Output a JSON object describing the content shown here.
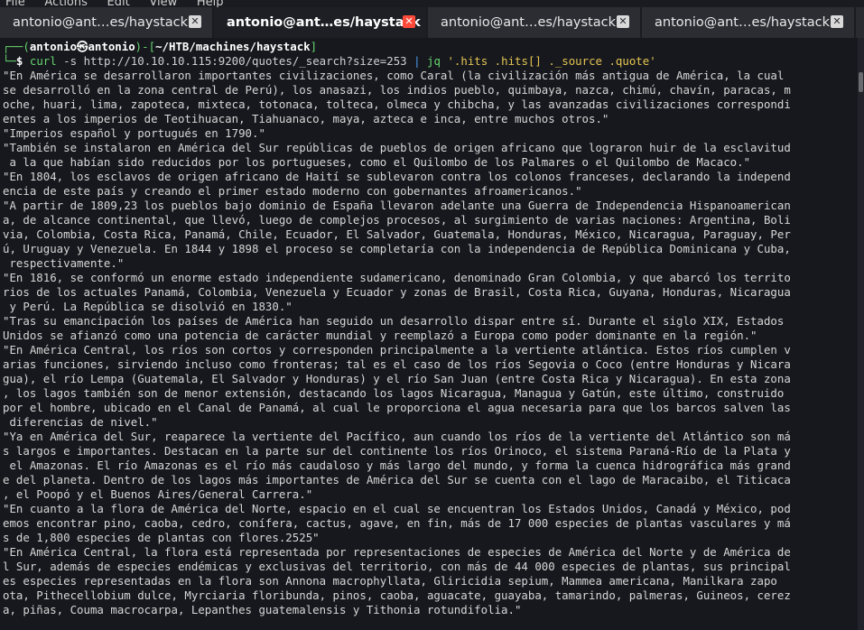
{
  "menubar": {
    "items": [
      "File",
      "Actions",
      "Edit",
      "View",
      "Help"
    ]
  },
  "tabs": [
    {
      "label": "antonio@ant…es/haystack",
      "active": false
    },
    {
      "label": "antonio@ant…es/haystack",
      "active": true
    },
    {
      "label": "antonio@ant…es/haystack",
      "active": false
    },
    {
      "label": "antonio@ant…es/haystack",
      "active": false
    }
  ],
  "colors": {
    "tab_close_active": "#ff4a3a",
    "prompt_blue": "#4c9be8",
    "prompt_green": "#66d36e"
  },
  "prompt": {
    "open": "┌──(",
    "user": "antonio㉿antonio",
    "mid": ")-[",
    "path": "~/HTB/machines/haystack",
    "close": "]",
    "second": "└─",
    "symbol": "$",
    "cmd_name": "curl",
    "cmd_flag": "-s",
    "cmd_url": "http://10.10.10.115:9200/quotes/_search?size=253",
    "pipe": "|",
    "cmd_jq": "jq",
    "cmd_filter": "'.hits .hits[] ._source .quote'"
  },
  "output_lines": [
    "\"En América se desarrollaron importantes civilizaciones, como Caral (la civilización más antigua de América, la cual",
    "se desarrolló en la zona central de Perú), los anasazi, los indios pueblo, quimbaya, nazca, chimú, chavín, paracas, m",
    "oche, huari, lima, zapoteca, mixteca, totonaca, tolteca, olmeca y chibcha, y las avanzadas civilizaciones correspondi",
    "entes a los imperios de Teotihuacan, Tiahuanaco, maya, azteca e inca, entre muchos otros.\"",
    "\"Imperios español y portugués en 1790.\"",
    "\"También se instalaron en América del Sur repúblicas de pueblos de origen africano que lograron huir de la esclavitud",
    " a la que habían sido reducidos por los portugueses, como el Quilombo de los Palmares o el Quilombo de Macaco.\"",
    "\"En 1804, los esclavos de origen africano de Haití se sublevaron contra los colonos franceses, declarando la independ",
    "encia de este país y creando el primer estado moderno con gobernantes afroamericanos.\"",
    "\"A partir de 1809,23 los pueblos bajo dominio de España llevaron adelante una Guerra de Independencia Hispanoamerican",
    "a, de alcance continental, que llevó, luego de complejos procesos, al surgimiento de varias naciones: Argentina, Boli",
    "via, Colombia, Costa Rica, Panamá, Chile, Ecuador, El Salvador, Guatemala, Honduras, México, Nicaragua, Paraguay, Per",
    "ú, Uruguay y Venezuela. En 1844 y 1898 el proceso se completaría con la independencia de República Dominicana y Cuba,",
    " respectivamente.\"",
    "\"En 1816, se conformó un enorme estado independiente sudamericano, denominado Gran Colombia, y que abarcó los territo",
    "rios de los actuales Panamá, Colombia, Venezuela y Ecuador y zonas de Brasil, Costa Rica, Guyana, Honduras, Nicaragua",
    " y Perú. La República se disolvió en 1830.\"",
    "\"Tras su emancipación los países de América han seguido un desarrollo dispar entre sí. Durante el siglo XIX, Estados",
    "Unidos se afianzó como una potencia de carácter mundial y reemplazó a Europa como poder dominante en la región.\"",
    "\"En América Central, los ríos son cortos y corresponden principalmente a la vertiente atlántica. Estos ríos cumplen v",
    "arias funciones, sirviendo incluso como fronteras; tal es el caso de los ríos Segovia o Coco (entre Honduras y Nicara",
    "gua), el río Lempa (Guatemala, El Salvador y Honduras) y el río San Juan (entre Costa Rica y Nicaragua). En esta zona",
    ", los lagos también son de menor extensión, destacando los lagos Nicaragua, Managua y Gatún, este último, construido",
    "por el hombre, ubicado en el Canal de Panamá, al cual le proporciona el agua necesaria para que los barcos salven las",
    " diferencias de nivel.\"",
    "\"Ya en América del Sur, reaparece la vertiente del Pacífico, aun cuando los ríos de la vertiente del Atlántico son má",
    "s largos e importantes. Destacan en la parte sur del continente los ríos Orinoco, el sistema Paraná-Río de la Plata y",
    " el Amazonas. El río Amazonas es el río más caudaloso y más largo del mundo, y forma la cuenca hidrográfica más grand",
    "e del planeta. Dentro de los lagos más importantes de América del Sur se cuenta con el lago de Maracaibo, el Titicaca",
    ", el Poopó y el Buenos Aires/General Carrera.\"",
    "\"En cuanto a la flora de América del Norte, espacio en el cual se encuentran los Estados Unidos, Canadá y México, pod",
    "emos encontrar pino, caoba, cedro, conífera, cactus, agave, en fin, más de 17 000 especies de plantas vasculares y má",
    "s de 1,800 especies de plantas con flores.2525\"",
    "\"En América Central, la flora está representada por representaciones de especies de América del Norte y de América de",
    "l Sur, además de especies endémicas y exclusivas del territorio, con más de 44 000 especies de plantas, sus principal",
    "es especies representadas en la flora son Annona macrophyllata, Gliricidia sepium, Mammea americana, Manilkara zapo",
    "ota, Pithecellobium dulce, Myrciaria floribunda, pinos, caoba, aguacate, guayaba, tamarindo, palmeras, Guineos, cerez",
    "a, piñas, Couma macrocarpa, Lepanthes guatemalensis y Tithonia rotundifolia.\""
  ]
}
